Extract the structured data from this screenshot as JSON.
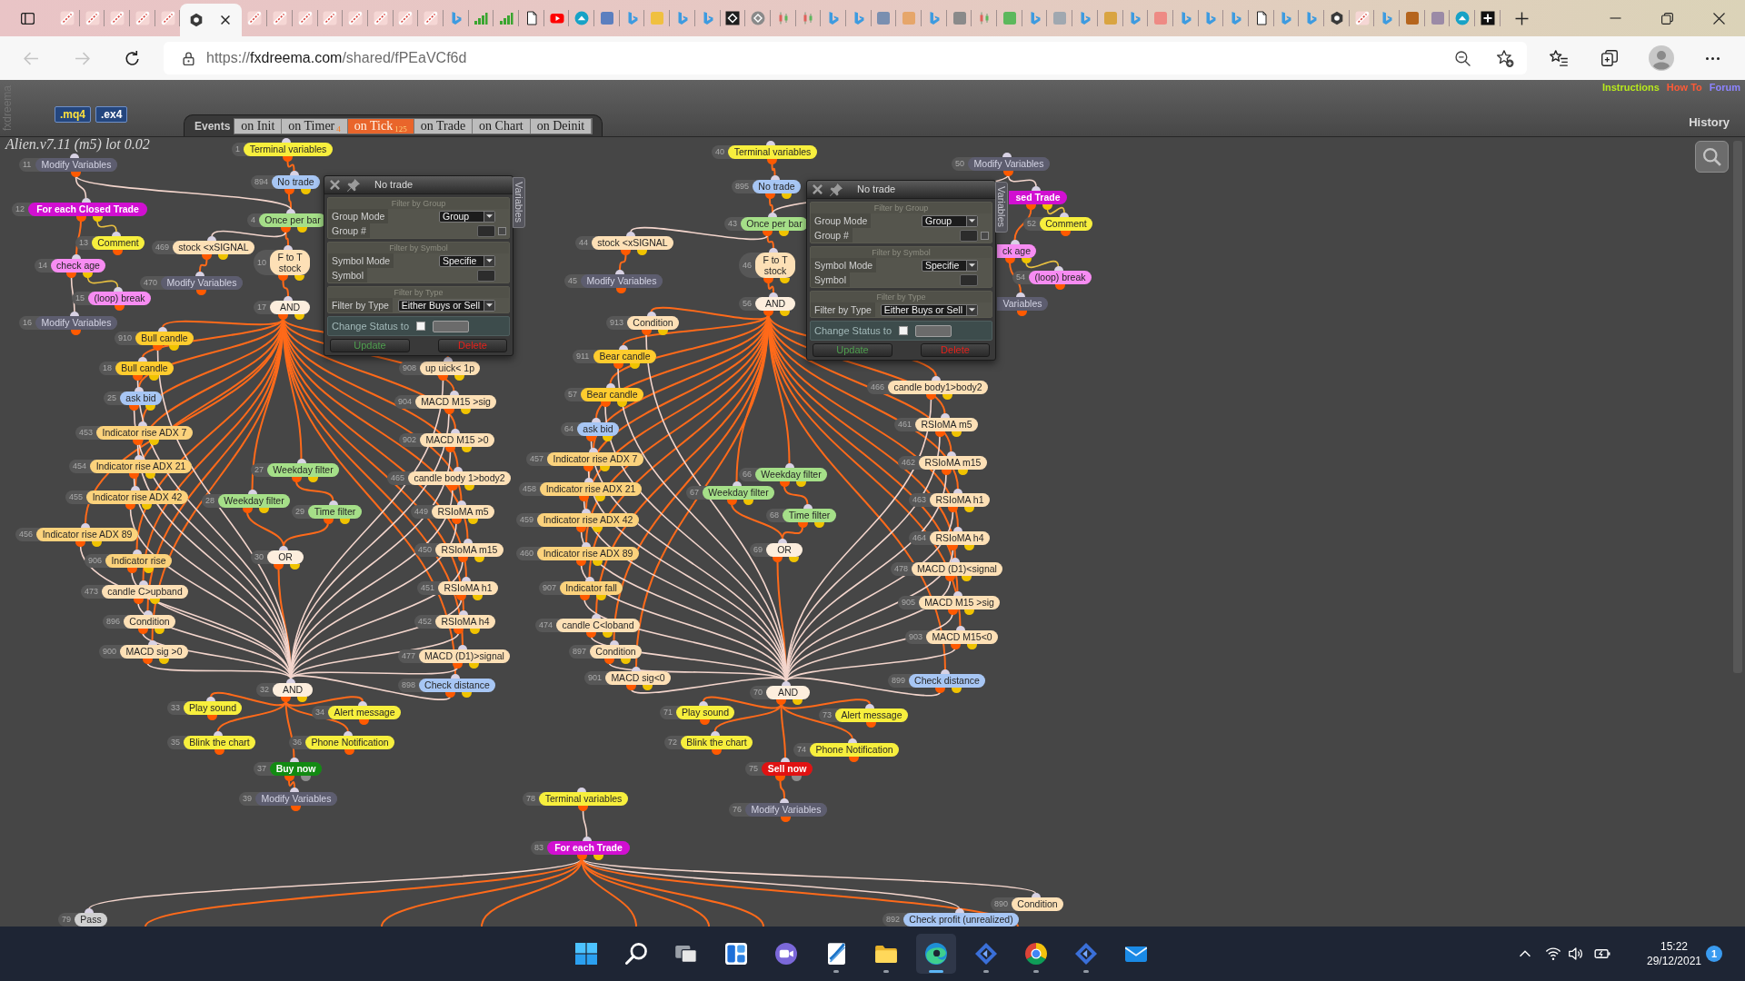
{
  "browser": {
    "tabs": [
      {
        "kind": "pencil",
        "selected": false
      },
      {
        "kind": "pencil",
        "selected": false
      },
      {
        "kind": "pencil",
        "selected": false
      },
      {
        "kind": "pencil",
        "selected": false
      },
      {
        "kind": "pencil",
        "selected": false
      },
      {
        "kind": "hexagon",
        "selected": true
      },
      {
        "kind": "pencil",
        "selected": false
      },
      {
        "kind": "pencil",
        "selected": false
      },
      {
        "kind": "pencil",
        "selected": false
      },
      {
        "kind": "pencil",
        "selected": false
      },
      {
        "kind": "pencil",
        "selected": false
      },
      {
        "kind": "pencil",
        "selected": false
      },
      {
        "kind": "pencil",
        "selected": false
      },
      {
        "kind": "pencil",
        "selected": false
      },
      {
        "kind": "ribbon",
        "selected": false
      },
      {
        "kind": "bars",
        "selected": false
      },
      {
        "kind": "bars",
        "selected": false
      },
      {
        "kind": "page",
        "selected": false
      },
      {
        "kind": "play",
        "selected": false
      },
      {
        "kind": "disc",
        "selected": false
      },
      {
        "kind": "tile",
        "color": "#5b7fbf",
        "selected": false
      },
      {
        "kind": "ribbon",
        "selected": false
      },
      {
        "kind": "tile",
        "color": "#f0c040",
        "selected": false
      },
      {
        "kind": "ribbon",
        "selected": false
      },
      {
        "kind": "ribbon",
        "selected": false
      },
      {
        "kind": "square",
        "selected": false
      },
      {
        "kind": "coin",
        "selected": false
      },
      {
        "kind": "candles",
        "selected": false
      },
      {
        "kind": "candles",
        "selected": false
      },
      {
        "kind": "ribbon",
        "selected": false
      },
      {
        "kind": "ribbon",
        "selected": false
      },
      {
        "kind": "tile",
        "color": "#7a8fb0",
        "selected": false
      },
      {
        "kind": "tile",
        "color": "#e6a66a",
        "selected": false
      },
      {
        "kind": "ribbon",
        "selected": false
      },
      {
        "kind": "tile",
        "color": "#8a8a8a",
        "selected": false
      },
      {
        "kind": "candles",
        "selected": false
      },
      {
        "kind": "tile",
        "color": "#5cb85c",
        "selected": false
      },
      {
        "kind": "ribbon",
        "selected": false
      },
      {
        "kind": "tile",
        "color": "#a0a8b0",
        "selected": false
      },
      {
        "kind": "ribbon",
        "selected": false
      },
      {
        "kind": "tile",
        "color": "#d9a441",
        "selected": false
      },
      {
        "kind": "ribbon",
        "selected": false
      },
      {
        "kind": "tile",
        "color": "#ee8a84",
        "selected": false
      },
      {
        "kind": "ribbon",
        "selected": false
      },
      {
        "kind": "ribbon",
        "selected": false
      },
      {
        "kind": "ribbon",
        "selected": false
      },
      {
        "kind": "page",
        "selected": false
      },
      {
        "kind": "ribbon",
        "selected": false
      },
      {
        "kind": "ribbon",
        "selected": false
      },
      {
        "kind": "hexagon",
        "selected": false
      },
      {
        "kind": "pencil",
        "selected": false
      },
      {
        "kind": "ribbon",
        "selected": false
      },
      {
        "kind": "tile",
        "color": "#b5651d",
        "selected": false
      },
      {
        "kind": "tile",
        "color": "#9b8aa6",
        "selected": false
      },
      {
        "kind": "disc",
        "selected": false
      },
      {
        "kind": "plus",
        "selected": false
      }
    ],
    "nav": [
      {
        "kind": "back",
        "disabled": true
      },
      {
        "kind": "forward",
        "disabled": true
      },
      {
        "kind": "reload",
        "disabled": false
      }
    ],
    "url": {
      "scheme": "https://",
      "host": "fxdreema.com",
      "path": "/shared/fPEaVCf6d"
    }
  },
  "app": {
    "brand": "fxdreema",
    "export_buttons": [
      {
        "label": ".mq4",
        "kind": "source"
      },
      {
        "label": ".ex4",
        "kind": "binary"
      }
    ],
    "events": {
      "label": "Events",
      "tabs": [
        {
          "label": "on Init",
          "selected": false
        },
        {
          "label": "on Timer",
          "count": "4",
          "selected": false
        },
        {
          "label": "on Tick",
          "count": "125",
          "selected": true
        },
        {
          "label": "on Trade",
          "selected": false
        },
        {
          "label": "on Chart",
          "selected": false
        },
        {
          "label": "on Deinit",
          "selected": false
        }
      ]
    },
    "links": [
      {
        "label": "Instructions",
        "color": "#b8ea1c"
      },
      {
        "label": "How To",
        "color": "#ff5a36"
      },
      {
        "label": "Forum",
        "color": "#8d84ff"
      }
    ],
    "history": "History",
    "project_title": "Alien.v7.11 (m5) lot 0.02",
    "blocks": [
      {
        "number": "1",
        "label": "Terminal variables",
        "kind": "action",
        "color": "#f7ef3d"
      },
      {
        "number": "40",
        "label": "Terminal variables",
        "kind": "action",
        "color": "#f7ef3d"
      },
      {
        "number": "11",
        "label": "Modify Variables",
        "kind": "action",
        "color": "#5d5d6f"
      },
      {
        "number": "50",
        "label": "Modify Variables",
        "kind": "action",
        "color": "#5d5d6f"
      },
      {
        "number": "894",
        "label": "No trade",
        "kind": "condition",
        "color": "#a7c6f4"
      },
      {
        "number": "895",
        "label": "No trade",
        "kind": "condition",
        "color": "#a7c6f4"
      },
      {
        "label": "sed Trade",
        "kind": "loop",
        "color": "#d10fd1"
      },
      {
        "number": "12",
        "label": "For each Closed Trade",
        "kind": "loop",
        "color": "#d10fd1"
      },
      {
        "number": "4",
        "label": "Once per bar",
        "kind": "condition",
        "color": "#a5df88"
      },
      {
        "number": "43",
        "label": "Once per bar",
        "kind": "condition",
        "color": "#a5df88"
      },
      {
        "number": "52",
        "label": "Comment",
        "kind": "action",
        "color": "#f7ef3d"
      },
      {
        "number": "13",
        "label": "Comment",
        "kind": "action",
        "color": "#f7ef3d"
      },
      {
        "number": "469",
        "label": "stock <xSIGNAL",
        "kind": "condition",
        "color": "#fde0b6"
      },
      {
        "number": "44",
        "label": "stock <xSIGNAL",
        "kind": "condition",
        "color": "#fde0b6"
      },
      {
        "label": "ck age",
        "kind": "condition",
        "color": "#f78cf2"
      },
      {
        "number": "14",
        "label": "check age",
        "kind": "condition",
        "color": "#f78cf2"
      },
      {
        "number": "10",
        "label": "F to T stock",
        "kind": "condition",
        "color": "#fde0b6"
      },
      {
        "number": "46",
        "label": "F to T stock",
        "kind": "condition",
        "color": "#fde0b6"
      },
      {
        "number": "470",
        "label": "Modify Variables",
        "kind": "action",
        "color": "#5d5d6f"
      },
      {
        "number": "45",
        "label": "Modify Variables",
        "kind": "action",
        "color": "#5d5d6f"
      },
      {
        "number": "54",
        "label": "(loop) break",
        "kind": "action",
        "color": "#f78cf2"
      },
      {
        "number": "15",
        "label": "(loop) break",
        "kind": "action",
        "color": "#f78cf2"
      },
      {
        "number": "56",
        "label": "AND",
        "kind": "condition",
        "color": "#fdeedd"
      },
      {
        "label": "Variables",
        "kind": "action",
        "color": "#5d5d6f"
      },
      {
        "number": "17",
        "label": "AND",
        "kind": "condition",
        "color": "#fdeedd"
      },
      {
        "number": "16",
        "label": "Modify Variables",
        "kind": "action",
        "color": "#5d5d6f"
      },
      {
        "number": "913",
        "label": "Condition",
        "kind": "condition",
        "color": "#fde0b6"
      },
      {
        "number": "910",
        "label": "Bull candle",
        "kind": "condition",
        "color": "#ffcc2e"
      },
      {
        "number": "911",
        "label": "Bear candle",
        "kind": "condition",
        "color": "#ffcc2e"
      },
      {
        "number": "18",
        "label": "Bull candle",
        "kind": "condition",
        "color": "#ffcc2e"
      },
      {
        "number": "908",
        "label": "up uick< 1p",
        "kind": "condition",
        "color": "#fde0b6"
      },
      {
        "number": "466",
        "label": "candle body1>body2",
        "kind": "condition",
        "color": "#fde0b6"
      },
      {
        "number": "25",
        "label": "ask bid",
        "kind": "condition",
        "color": "#a7c6f4"
      },
      {
        "number": "904",
        "label": "MACD M15 >sig",
        "kind": "condition",
        "color": "#fde0b6"
      },
      {
        "number": "57",
        "label": "Bear candle",
        "kind": "condition",
        "color": "#ffcc2e"
      },
      {
        "number": "64",
        "label": "ask bid",
        "kind": "condition",
        "color": "#a7c6f4"
      },
      {
        "number": "461",
        "label": "RSIoMA m5",
        "kind": "condition",
        "color": "#fde0b6"
      },
      {
        "number": "453",
        "label": "Indicator rise ADX 7",
        "kind": "condition",
        "color": "#fbd27c"
      },
      {
        "number": "902",
        "label": "MACD M15 >0",
        "kind": "condition",
        "color": "#fde0b6"
      },
      {
        "number": "454",
        "label": "Indicator rise ADX 21",
        "kind": "condition",
        "color": "#fbd27c"
      },
      {
        "number": "457",
        "label": "Indicator rise ADX 7",
        "kind": "condition",
        "color": "#fbd27c"
      },
      {
        "number": "462",
        "label": "RSIoMA m15",
        "kind": "condition",
        "color": "#fde0b6"
      },
      {
        "number": "27",
        "label": "Weekday filter",
        "kind": "condition",
        "color": "#a5df88"
      },
      {
        "number": "66",
        "label": "Weekday filter",
        "kind": "condition",
        "color": "#a5df88"
      },
      {
        "number": "465",
        "label": "candle body 1>body2",
        "kind": "condition",
        "color": "#fde0b6"
      },
      {
        "number": "455",
        "label": "Indicator rise ADX 42",
        "kind": "condition",
        "color": "#fbd27c"
      },
      {
        "number": "28",
        "label": "Weekday filter",
        "kind": "condition",
        "color": "#a5df88"
      },
      {
        "number": "458",
        "label": "Indicator rise ADX 21",
        "kind": "condition",
        "color": "#fbd27c"
      },
      {
        "number": "67",
        "label": "Weekday filter",
        "kind": "condition",
        "color": "#a5df88"
      },
      {
        "number": "463",
        "label": "RSIoMA h1",
        "kind": "condition",
        "color": "#fde0b6"
      },
      {
        "number": "29",
        "label": "Time filter",
        "kind": "condition",
        "color": "#a5df88"
      },
      {
        "number": "449",
        "label": "RSIoMA m5",
        "kind": "condition",
        "color": "#fde0b6"
      },
      {
        "number": "68",
        "label": "Time filter",
        "kind": "condition",
        "color": "#a5df88"
      },
      {
        "number": "459",
        "label": "Indicator rise ADX 42",
        "kind": "condition",
        "color": "#fbd27c"
      },
      {
        "number": "456",
        "label": "Indicator rise ADX 89",
        "kind": "condition",
        "color": "#fbd27c"
      },
      {
        "number": "464",
        "label": "RSIoMA h4",
        "kind": "condition",
        "color": "#fde0b6"
      },
      {
        "number": "30",
        "label": "OR",
        "kind": "condition",
        "color": "#fdeedd"
      },
      {
        "number": "450",
        "label": "RSIoMA m15",
        "kind": "condition",
        "color": "#fde0b6"
      },
      {
        "number": "460",
        "label": "Indicator rise ADX 89",
        "kind": "condition",
        "color": "#fbd27c"
      },
      {
        "number": "69",
        "label": "OR",
        "kind": "condition",
        "color": "#fdeedd"
      },
      {
        "number": "906",
        "label": "Indicator rise",
        "kind": "condition",
        "color": "#fbd27c"
      },
      {
        "number": "478",
        "label": "MACD (D1)<signal",
        "kind": "condition",
        "color": "#fde0b6"
      },
      {
        "number": "473",
        "label": "candle C>upband",
        "kind": "condition",
        "color": "#fde0b6"
      },
      {
        "number": "451",
        "label": "RSIoMA h1",
        "kind": "condition",
        "color": "#fde0b6"
      },
      {
        "number": "907",
        "label": "Indicator fall",
        "kind": "condition",
        "color": "#fbd27c"
      },
      {
        "number": "905",
        "label": "MACD M15 >sig",
        "kind": "condition",
        "color": "#fde0b6"
      },
      {
        "number": "896",
        "label": "Condition",
        "kind": "condition",
        "color": "#fde0b6"
      },
      {
        "number": "452",
        "label": "RSIoMA h4",
        "kind": "condition",
        "color": "#fde0b6"
      },
      {
        "number": "474",
        "label": "candle C<loband",
        "kind": "condition",
        "color": "#fde0b6"
      },
      {
        "number": "903",
        "label": "MACD M15<0",
        "kind": "condition",
        "color": "#fde0b6"
      },
      {
        "number": "900",
        "label": "MACD sig >0",
        "kind": "condition",
        "color": "#fde0b6"
      },
      {
        "number": "477",
        "label": "MACD (D1)>signal",
        "kind": "condition",
        "color": "#fde0b6"
      },
      {
        "number": "897",
        "label": "Condition",
        "kind": "condition",
        "color": "#fde0b6"
      },
      {
        "number": "898",
        "label": "Check distance",
        "kind": "condition",
        "color": "#a7c6f4"
      },
      {
        "number": "901",
        "label": "MACD sig<0",
        "kind": "condition",
        "color": "#fde0b6"
      },
      {
        "number": "899",
        "label": "Check distance",
        "kind": "condition",
        "color": "#a7c6f4"
      },
      {
        "number": "32",
        "label": "AND",
        "kind": "condition",
        "color": "#fdeedd"
      },
      {
        "number": "70",
        "label": "AND",
        "kind": "condition",
        "color": "#fdeedd"
      },
      {
        "number": "33",
        "label": "Play sound",
        "kind": "action",
        "color": "#f7ef3d"
      },
      {
        "number": "34",
        "label": "Alert message",
        "kind": "action",
        "color": "#f7ef3d"
      },
      {
        "number": "71",
        "label": "Play sound",
        "kind": "action",
        "color": "#f7ef3d"
      },
      {
        "number": "73",
        "label": "Alert message",
        "kind": "action",
        "color": "#f7ef3d"
      },
      {
        "number": "35",
        "label": "Blink the chart",
        "kind": "action",
        "color": "#f7ef3d"
      },
      {
        "number": "36",
        "label": "Phone Notification",
        "kind": "action",
        "color": "#f7ef3d"
      },
      {
        "number": "72",
        "label": "Blink the chart",
        "kind": "action",
        "color": "#f7ef3d"
      },
      {
        "number": "74",
        "label": "Phone Notification",
        "kind": "action",
        "color": "#f7ef3d"
      },
      {
        "number": "37",
        "label": "Buy now",
        "kind": "order",
        "color": "#128a12"
      },
      {
        "number": "75",
        "label": "Sell now",
        "kind": "order",
        "color": "#e01212"
      },
      {
        "number": "39",
        "label": "Modify Variables",
        "kind": "action",
        "color": "#5d5d6f"
      },
      {
        "number": "78",
        "label": "Terminal variables",
        "kind": "action",
        "color": "#f7ef3d"
      },
      {
        "number": "76",
        "label": "Modify Variables",
        "kind": "action",
        "color": "#5d5d6f"
      },
      {
        "number": "83",
        "label": "For each Trade",
        "kind": "loop",
        "color": "#d10fd1"
      },
      {
        "number": "890",
        "label": "Condition",
        "kind": "condition",
        "color": "#fde0b6"
      },
      {
        "number": "79",
        "label": "Pass",
        "kind": "action",
        "color": "#d0d0d0"
      },
      {
        "number": "892",
        "label": "Check profit (unrealized)",
        "kind": "condition",
        "color": "#a7c6f4"
      }
    ],
    "popups": [
      {
        "title": "No trade",
        "tab": "Variables",
        "sections": [
          {
            "header": "Filter by Group",
            "rows": [
              {
                "label": "Group Mode",
                "kind": "select",
                "value": "Group"
              },
              {
                "label": "Group #",
                "kind": "field",
                "checked": false
              }
            ]
          },
          {
            "header": "Filter by Symbol",
            "rows": [
              {
                "label": "Symbol Mode",
                "kind": "select",
                "value": "Specifie"
              },
              {
                "label": "Symbol",
                "kind": "field"
              }
            ]
          },
          {
            "header": "Filter by Type",
            "rows": [
              {
                "label": "Filter by Type",
                "kind": "select",
                "value": "Either Buys or Sell"
              }
            ]
          }
        ],
        "status": {
          "label": "Change Status to",
          "checked": false
        },
        "buttons": [
          {
            "label": "Update",
            "kind": "confirm"
          },
          {
            "label": "Delete",
            "kind": "danger"
          }
        ]
      },
      {
        "title": "No trade",
        "tab": "Variables",
        "sections": [
          {
            "header": "Filter by Group",
            "rows": [
              {
                "label": "Group Mode",
                "kind": "select",
                "value": "Group"
              },
              {
                "label": "Group #",
                "kind": "field",
                "checked": false
              }
            ]
          },
          {
            "header": "Filter by Symbol",
            "rows": [
              {
                "label": "Symbol Mode",
                "kind": "select",
                "value": "Specifie"
              },
              {
                "label": "Symbol",
                "kind": "field"
              }
            ]
          },
          {
            "header": "Filter by Type",
            "rows": [
              {
                "label": "Filter by Type",
                "kind": "select",
                "value": "Either Buys or Sell"
              }
            ]
          }
        ],
        "status": {
          "label": "Change Status to",
          "checked": false
        },
        "buttons": [
          {
            "label": "Update",
            "kind": "confirm"
          },
          {
            "label": "Delete",
            "kind": "danger"
          }
        ]
      }
    ]
  },
  "taskbar": {
    "apps": [
      {
        "kind": "start",
        "running": false,
        "active": false
      },
      {
        "kind": "search",
        "running": false,
        "active": false
      },
      {
        "kind": "taskview",
        "running": false,
        "active": false
      },
      {
        "kind": "widgets",
        "running": false,
        "active": false
      },
      {
        "kind": "chat",
        "running": false,
        "active": false
      },
      {
        "kind": "swoosh",
        "running": true,
        "active": false
      },
      {
        "kind": "folder",
        "running": true,
        "active": false
      },
      {
        "kind": "browser",
        "running": true,
        "active": true
      },
      {
        "kind": "studio",
        "running": true,
        "active": false
      },
      {
        "kind": "wheel",
        "running": true,
        "active": false
      },
      {
        "kind": "studio",
        "running": true,
        "active": false
      },
      {
        "kind": "mail",
        "running": false,
        "active": false
      }
    ],
    "time": "15:22",
    "date": "29/12/2021",
    "notifications": "1"
  }
}
